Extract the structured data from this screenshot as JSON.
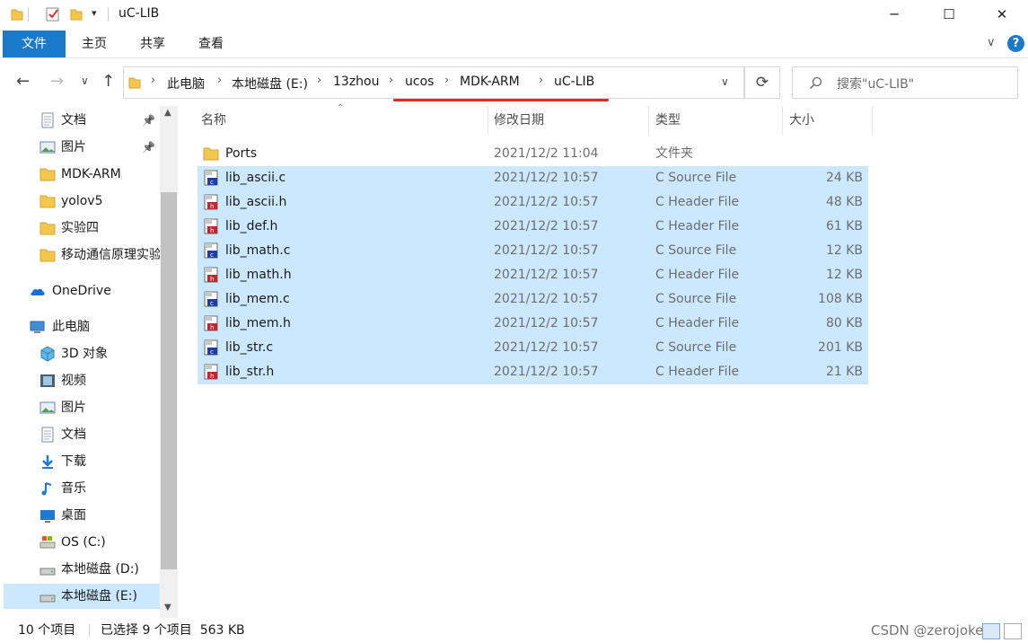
{
  "window": {
    "title": "uC-LIB",
    "minimize": "─",
    "maximize": "☐",
    "close": "✕"
  },
  "ribbon": {
    "tabs": [
      "文件",
      "主页",
      "共享",
      "查看"
    ],
    "expand": "∨",
    "help": "?"
  },
  "address": {
    "crumbs": [
      "此电脑",
      "本地磁盘 (E:)",
      "13zhou",
      "ucos",
      "MDK-ARM",
      "uC-LIB"
    ],
    "underline_color": "#e8242c"
  },
  "search": {
    "placeholder": "搜索\"uC-LIB\""
  },
  "sidebar": {
    "items": [
      {
        "label": "文档",
        "icon": "documents-icon",
        "pinned": true
      },
      {
        "label": "图片",
        "icon": "pictures-icon",
        "pinned": true
      },
      {
        "label": "MDK-ARM",
        "icon": "folder-icon"
      },
      {
        "label": "yolov5",
        "icon": "folder-icon"
      },
      {
        "label": "实验四",
        "icon": "folder-icon"
      },
      {
        "label": "移动通信原理实验",
        "icon": "folder-icon"
      },
      {
        "label": "OneDrive",
        "icon": "onedrive-icon"
      },
      {
        "label": "此电脑",
        "icon": "this-pc-icon"
      },
      {
        "label": "3D 对象",
        "icon": "3d-objects-icon"
      },
      {
        "label": "视频",
        "icon": "videos-icon"
      },
      {
        "label": "图片",
        "icon": "pictures-icon"
      },
      {
        "label": "文档",
        "icon": "documents-icon"
      },
      {
        "label": "下载",
        "icon": "downloads-icon"
      },
      {
        "label": "音乐",
        "icon": "music-icon"
      },
      {
        "label": "桌面",
        "icon": "desktop-icon"
      },
      {
        "label": "OS (C:)",
        "icon": "os-drive-icon"
      },
      {
        "label": "本地磁盘 (D:)",
        "icon": "drive-icon"
      },
      {
        "label": "本地磁盘 (E:)",
        "icon": "drive-icon",
        "selected": true
      }
    ]
  },
  "columns": {
    "name": "名称",
    "date": "修改日期",
    "type": "类型",
    "size": "大小"
  },
  "files": [
    {
      "name": "Ports",
      "date": "2021/12/2 11:04",
      "type": "文件夹",
      "size": "",
      "kind": "folder",
      "selected": false
    },
    {
      "name": "lib_ascii.c",
      "date": "2021/12/2 10:57",
      "type": "C Source File",
      "size": "24 KB",
      "kind": "c",
      "selected": true
    },
    {
      "name": "lib_ascii.h",
      "date": "2021/12/2 10:57",
      "type": "C Header File",
      "size": "48 KB",
      "kind": "h",
      "selected": true
    },
    {
      "name": "lib_def.h",
      "date": "2021/12/2 10:57",
      "type": "C Header File",
      "size": "61 KB",
      "kind": "h",
      "selected": true
    },
    {
      "name": "lib_math.c",
      "date": "2021/12/2 10:57",
      "type": "C Source File",
      "size": "12 KB",
      "kind": "c",
      "selected": true
    },
    {
      "name": "lib_math.h",
      "date": "2021/12/2 10:57",
      "type": "C Header File",
      "size": "12 KB",
      "kind": "h",
      "selected": true
    },
    {
      "name": "lib_mem.c",
      "date": "2021/12/2 10:57",
      "type": "C Source File",
      "size": "108 KB",
      "kind": "c",
      "selected": true
    },
    {
      "name": "lib_mem.h",
      "date": "2021/12/2 10:57",
      "type": "C Header File",
      "size": "80 KB",
      "kind": "h",
      "selected": true
    },
    {
      "name": "lib_str.c",
      "date": "2021/12/2 10:57",
      "type": "C Source File",
      "size": "201 KB",
      "kind": "c",
      "selected": true
    },
    {
      "name": "lib_str.h",
      "date": "2021/12/2 10:57",
      "type": "C Header File",
      "size": "21 KB",
      "kind": "h",
      "selected": true
    }
  ],
  "status": {
    "count": "10 个项目",
    "selection": "已选择 9 个项目  563 KB"
  },
  "watermark": "CSDN @zerojoker1"
}
